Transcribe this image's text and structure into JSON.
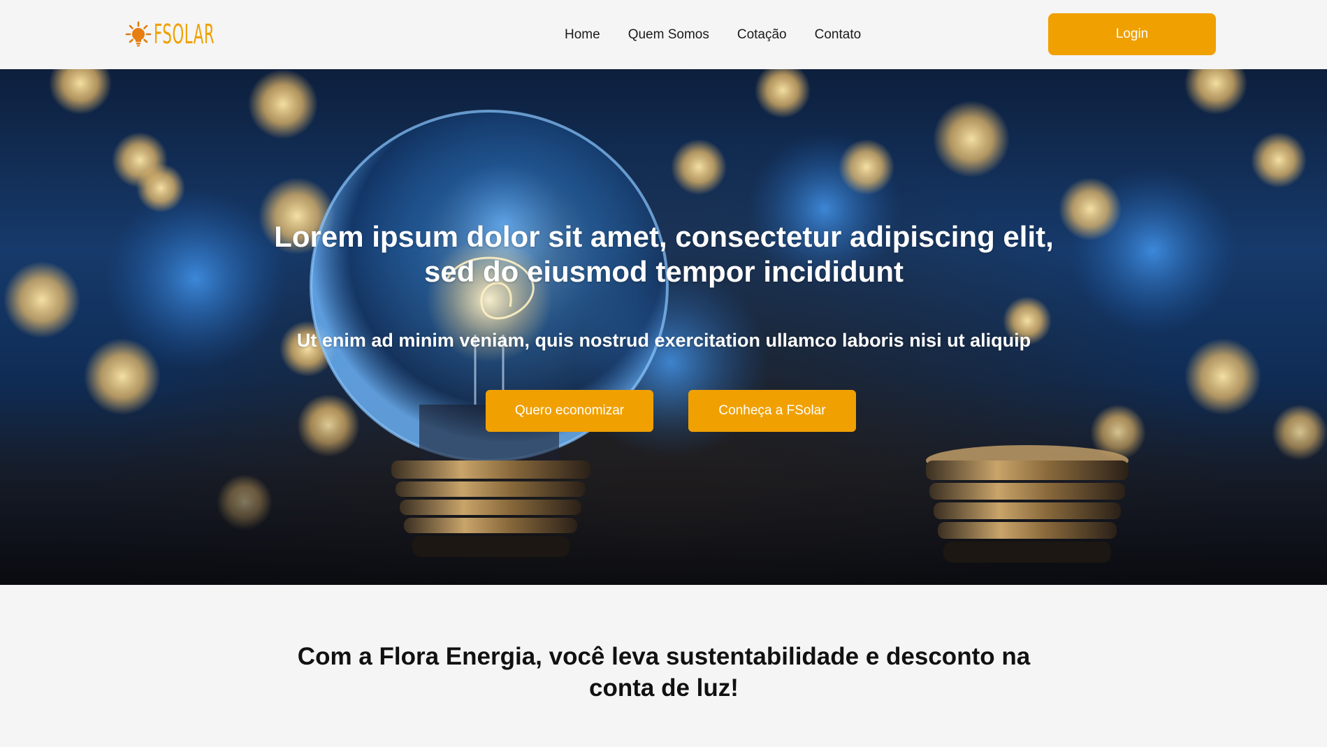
{
  "header": {
    "logo_text": "FSOLAR",
    "nav": [
      {
        "label": "Home"
      },
      {
        "label": "Quem Somos"
      },
      {
        "label": "Cotação"
      },
      {
        "label": "Contato"
      }
    ],
    "login_label": "Login"
  },
  "hero": {
    "title": "Lorem ipsum dolor sit amet, consectetur adipiscing elit, sed do eiusmod tempor incididunt",
    "subtitle": "Ut enim ad minim veniam, quis nostrud exercitation ullamco laboris nisi ut aliquip",
    "primary_button": "Quero economizar",
    "secondary_button": "Conheça a FSolar",
    "background_image": "light-bulb-bokeh"
  },
  "section": {
    "title": "Com a Flora Energia, você leva sustentabilidade e desconto na conta de luz!"
  },
  "colors": {
    "accent": "#f0a000",
    "background": "#f5f5f5",
    "text_dark": "#111111"
  }
}
